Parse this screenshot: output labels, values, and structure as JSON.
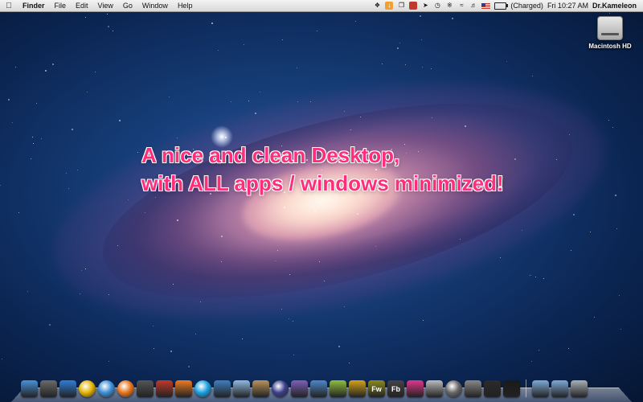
{
  "menubar": {
    "apple_icon": "apple-icon",
    "menus": [
      "Finder",
      "File",
      "Edit",
      "View",
      "Go",
      "Window",
      "Help"
    ],
    "battery_status": "(Charged)",
    "clock": "Fri 10:27 AM",
    "user": "Dr.Kameleon"
  },
  "desktop": {
    "drive_label": "Macintosh HD",
    "headline_line1": "A nice and clean Desktop,",
    "headline_line2": "with ALL apps / windows minimized!"
  },
  "colors": {
    "headline": "#ff2e7a",
    "menubar": "#e6e6e6"
  },
  "dock": {
    "apps": [
      {
        "icon": "finder-icon",
        "color": "#4a90d9"
      },
      {
        "icon": "launchpad-icon",
        "color": "#6a6a6a"
      },
      {
        "icon": "app-store-icon",
        "color": "#2f7ed8"
      },
      {
        "icon": "chrome-icon",
        "color": "#e8b400"
      },
      {
        "icon": "safari-icon",
        "color": "#3d8fd6"
      },
      {
        "icon": "firefox-icon",
        "color": "#e8751a"
      },
      {
        "icon": "scissors-icon",
        "color": "#555555"
      },
      {
        "icon": "pokerstars-icon",
        "color": "#c0392b"
      },
      {
        "icon": "xampp-icon",
        "color": "#f07b1f"
      },
      {
        "icon": "skype-icon",
        "color": "#1ba1e2"
      },
      {
        "icon": "mail-icon",
        "color": "#3f7fbf"
      },
      {
        "icon": "box-icon",
        "color": "#8fb9e0"
      },
      {
        "icon": "archive-icon",
        "color": "#b8935a"
      },
      {
        "icon": "eclipse-icon",
        "color": "#3b3f8a"
      },
      {
        "icon": "paint-icon",
        "color": "#7d5fb8"
      },
      {
        "icon": "xcode-icon",
        "color": "#4d87c7"
      },
      {
        "icon": "pencil-icon",
        "color": "#8fbf3f"
      },
      {
        "icon": "scrapbook-icon",
        "color": "#d4a21a"
      },
      {
        "icon": "fireworks-icon",
        "color": "#8a8a20",
        "label": "Fw"
      },
      {
        "icon": "flash-builder-icon",
        "color": "#444444",
        "label": "Fb"
      },
      {
        "icon": "heart-icon",
        "color": "#e2368a"
      },
      {
        "icon": "grapher-icon",
        "color": "#bbbbbb"
      },
      {
        "icon": "disk-utility-icon",
        "color": "#666666"
      },
      {
        "icon": "system-preferences-icon",
        "color": "#888888"
      },
      {
        "icon": "activity-monitor-icon",
        "color": "#2b2b2b"
      },
      {
        "icon": "terminal-icon",
        "color": "#1a1a1a"
      }
    ],
    "folders": [
      {
        "icon": "applications-folder-icon",
        "color": "#7ea9d6"
      },
      {
        "icon": "documents-folder-icon",
        "color": "#7ea9d6"
      },
      {
        "icon": "trash-icon",
        "color": "#a8b0b8"
      }
    ]
  }
}
